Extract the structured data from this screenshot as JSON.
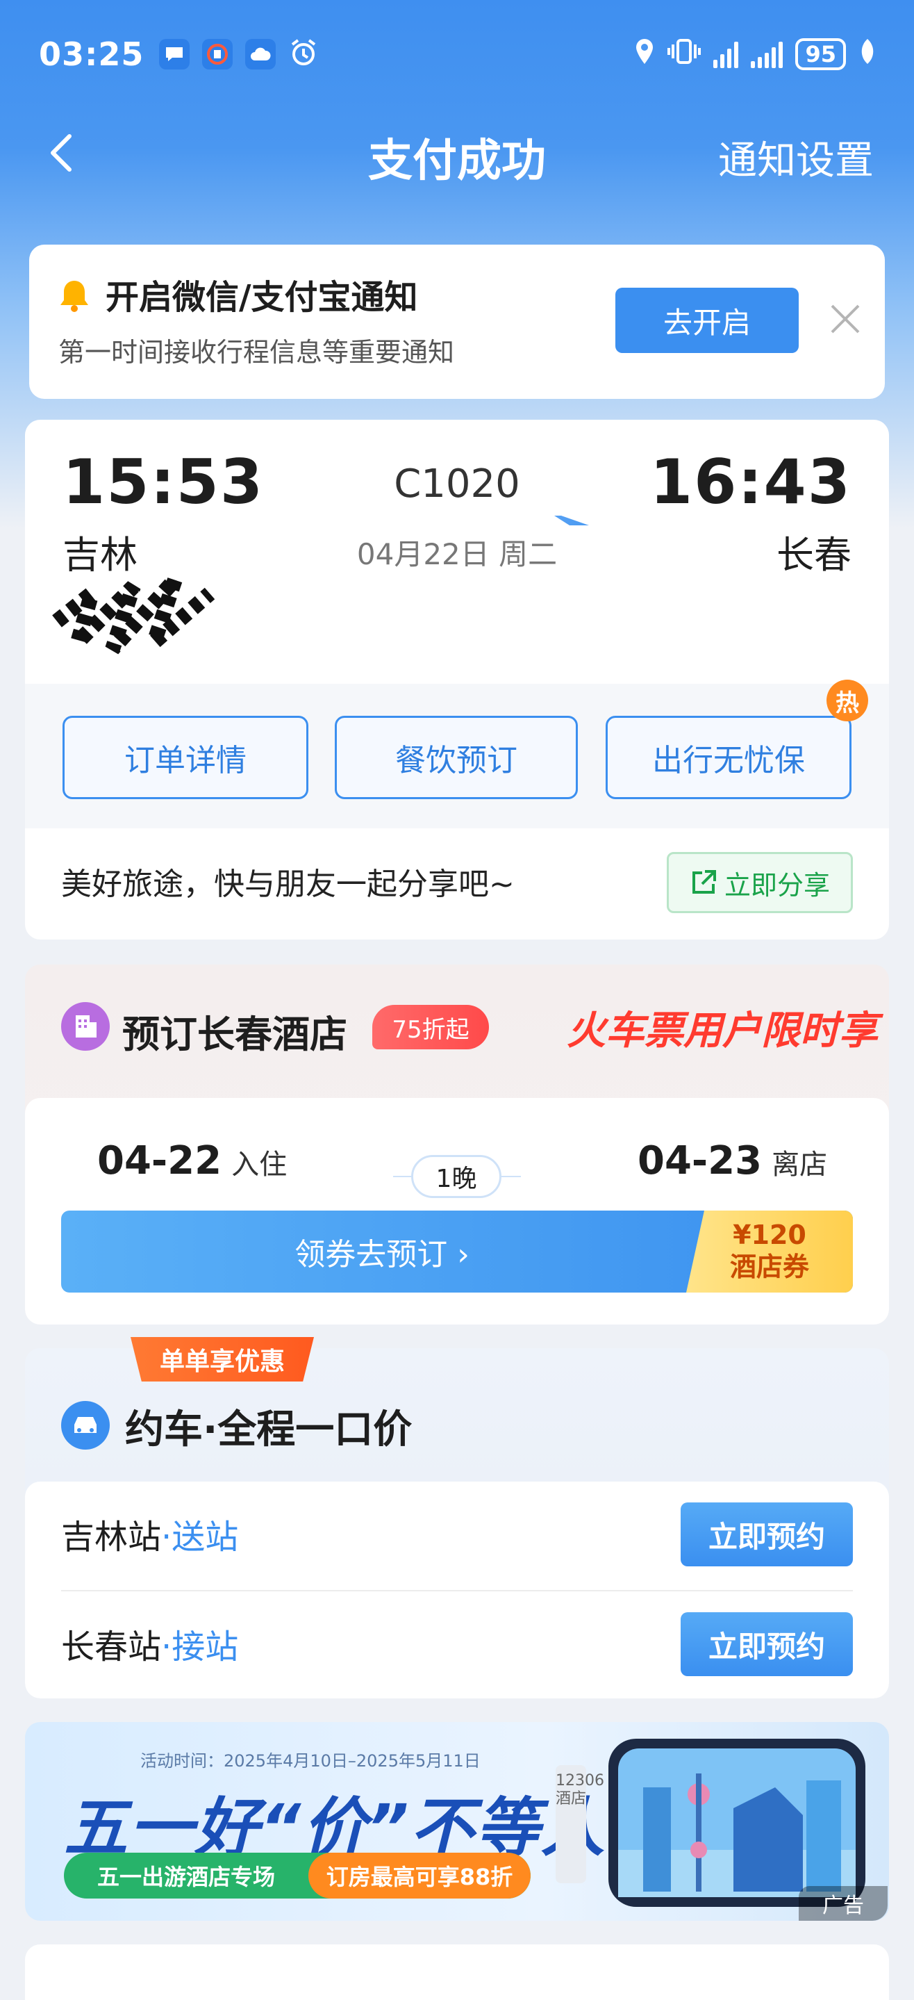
{
  "status_bar": {
    "time": "03:25",
    "battery": "95",
    "icons": [
      "chat-icon",
      "railway-app-icon",
      "cloud-icon",
      "alarm-icon",
      "location-icon",
      "vibrate-icon",
      "signal-icon",
      "signal-icon",
      "battery-icon",
      "leaf-icon"
    ]
  },
  "nav": {
    "title": "支付成功",
    "right_link": "通知设置"
  },
  "notification": {
    "title": "开启微信/支付宝通知",
    "subtitle": "第一时间接收行程信息等重要通知",
    "button": "去开启"
  },
  "trip": {
    "depart_time": "15:53",
    "depart_city": "吉林",
    "train_no": "C1020",
    "date": "04月22日 周二",
    "arrive_time": "16:43",
    "arrive_city": "长春"
  },
  "actions": {
    "order_detail": "订单详情",
    "dining": "餐饮预订",
    "insurance": "出行无忧保",
    "hot_badge": "热"
  },
  "share": {
    "text": "美好旅途，快与朋友一起分享吧~",
    "button": "立即分享"
  },
  "hotel": {
    "title": "预订长春酒店",
    "discount_badge": "75折起",
    "slogan": "火车票用户限时享",
    "checkin_date": "04-22",
    "checkin_label": "入住",
    "nights": "1晚",
    "checkout_date": "04-23",
    "checkout_label": "离店",
    "cta": "领券去预订 ›",
    "coupon_amount": "¥120",
    "coupon_label": "酒店券"
  },
  "car": {
    "ribbon": "单单享优惠",
    "title": "约车·全程一口价",
    "rows": [
      {
        "station": "吉林站",
        "kind": "·送站",
        "button": "立即预约"
      },
      {
        "station": "长春站",
        "kind": "·接站",
        "button": "立即预约"
      }
    ]
  },
  "banner": {
    "date_range": "活动时间：2025年4月10日–2025年5月11日",
    "title": "五一好“价”不等人",
    "pill_left": "五一出游酒店专场",
    "pill_right": "订房最高可享88折",
    "side_tag": "12306酒店",
    "ad_label": "广告"
  },
  "colors": {
    "primary": "#3b8ff0",
    "hot": "#ff8a1f",
    "share_green": "#1aa34a",
    "hotel_red": "#ff3b2f"
  }
}
